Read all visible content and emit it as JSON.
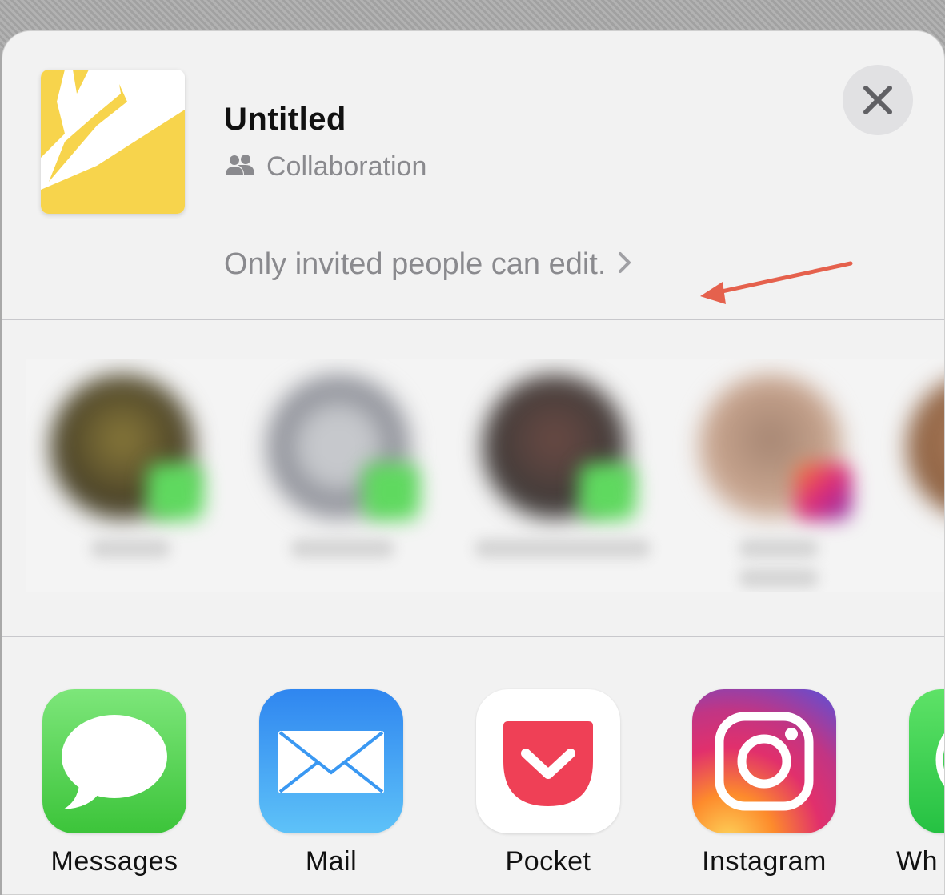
{
  "document": {
    "title": "Untitled",
    "subtitle": "Collaboration",
    "permission_text": "Only invited people can edit."
  },
  "colors": {
    "thumbnail_yellow": "#f7d44c",
    "annotation_arrow": "#e5614d",
    "secondary_text": "#8a8a8e"
  },
  "icons": {
    "close": "close-icon",
    "collaboration": "people-icon",
    "permission_chevron": "chevron-right-icon"
  },
  "share_apps": [
    {
      "label": "Messages",
      "icon": "messages-icon"
    },
    {
      "label": "Mail",
      "icon": "mail-icon"
    },
    {
      "label": "Pocket",
      "icon": "pocket-icon"
    },
    {
      "label": "Instagram",
      "icon": "instagram-icon"
    },
    {
      "label": "Wh",
      "icon": "whatsapp-icon"
    }
  ]
}
